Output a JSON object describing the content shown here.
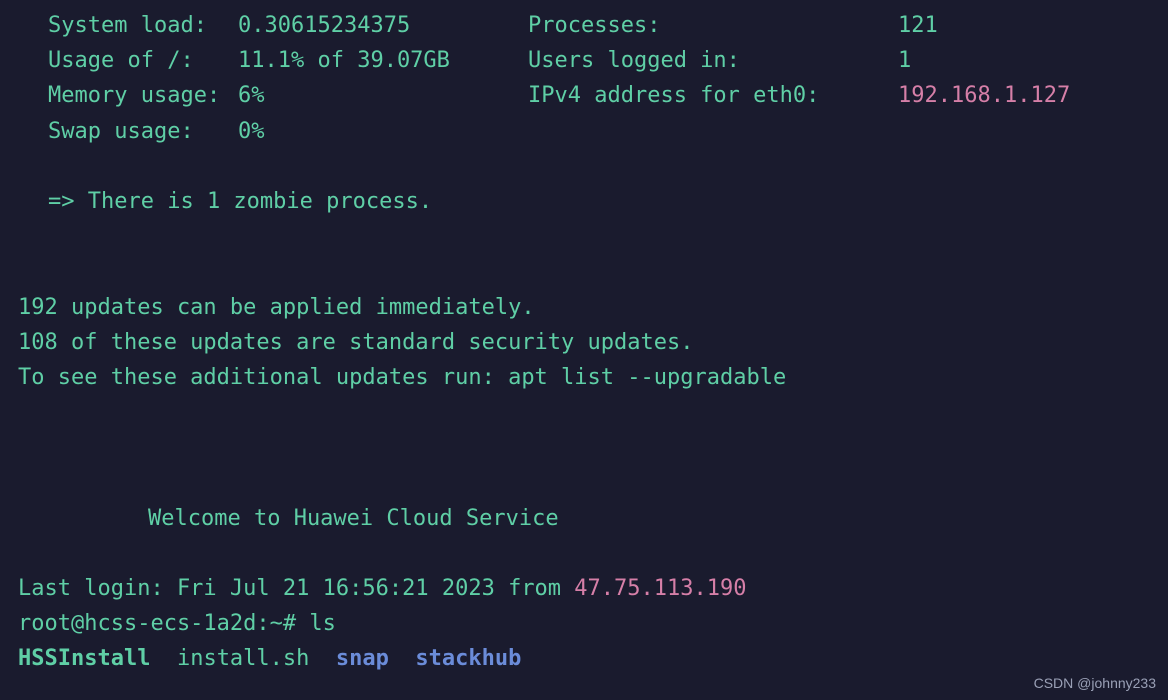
{
  "sys": {
    "load_label": "System load:",
    "load": "0.30615234375",
    "processes_label": "Processes:",
    "processes": "121",
    "disk_label": "Usage of /:",
    "disk": "11.1% of 39.07GB",
    "users_label": "Users logged in:",
    "users": "1",
    "mem_label": "Memory usage:",
    "mem": "6%",
    "ip_label": "IPv4 address for eth0:",
    "ip": "192.168.1.127",
    "swap_label": "Swap usage:",
    "swap": "0%"
  },
  "zombie": "=> There is 1 zombie process.",
  "updates": {
    "l1": "192 updates can be applied immediately.",
    "l2": "108 of these updates are standard security updates.",
    "l3": "To see these additional updates run: apt list --upgradable"
  },
  "welcome": "Welcome to Huawei Cloud Service",
  "last_login": {
    "prefix": "Last login: Fri Jul 21 16:56:21 2023 from ",
    "ip": "47.75.113.190"
  },
  "prompt": {
    "p1": "root@hcss-ecs-1a2d:~# ",
    "cmd1": "ls"
  },
  "ls": {
    "f1": "HSSInstall",
    "f2": "install.sh",
    "f3": "snap",
    "f4": "stackhub"
  },
  "watermark": "CSDN @johnny233"
}
